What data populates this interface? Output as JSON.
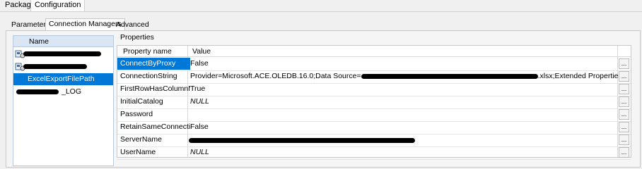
{
  "top_tabs": [
    {
      "label": "Package"
    },
    {
      "label": "Configuration"
    }
  ],
  "inner_tabs": [
    {
      "label": "Parameters"
    },
    {
      "label": "Connection Managers"
    },
    {
      "label": "Advanced"
    }
  ],
  "connection_managers": {
    "header": "Name",
    "items": [
      {
        "label": "",
        "redacted": true
      },
      {
        "label": "",
        "redacted": true
      },
      {
        "label": "ExcelExportFilePath",
        "selected": true
      },
      {
        "label": "_LOG",
        "redacted_prefix": true
      }
    ]
  },
  "properties": {
    "title": "Properties",
    "col_name": "Property name",
    "col_value": "Value",
    "rows": [
      {
        "name": "ConnectByProxy",
        "value": "False",
        "selected": true
      },
      {
        "name": "ConnectionString",
        "value": "Provider=Microsoft.ACE.OLEDB.16.0;Data Source=",
        "value_suffix": ".xlsx;Extended Properties=..."
      },
      {
        "name": "FirstRowHasColumnN...",
        "value": "True"
      },
      {
        "name": "InitialCatalog",
        "value": "NULL",
        "italic": true
      },
      {
        "name": "Password",
        "value": ""
      },
      {
        "name": "RetainSameConnection",
        "value": "False"
      },
      {
        "name": "ServerName",
        "value": "",
        "redacted": true
      },
      {
        "name": "UserName",
        "value": "NULL",
        "italic": true
      }
    ],
    "ellipsis": "..."
  }
}
